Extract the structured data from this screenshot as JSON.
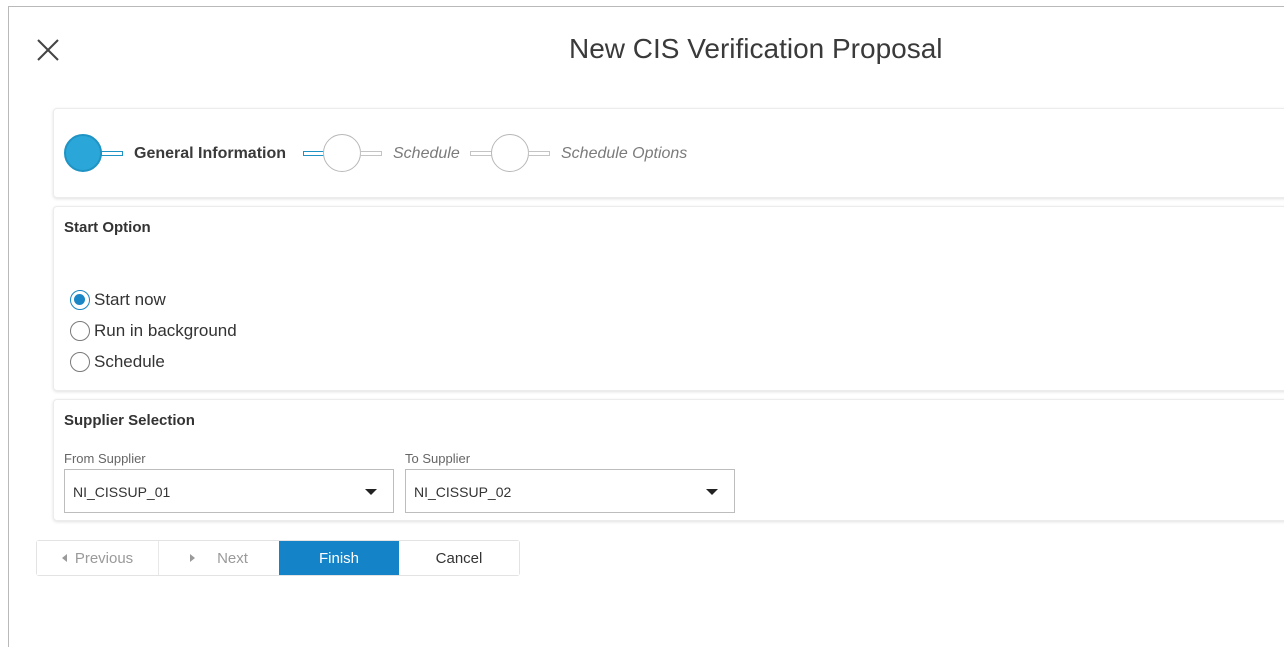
{
  "dialog": {
    "title": "New CIS Verification Proposal",
    "close_icon": "close-icon"
  },
  "wizard": {
    "steps": [
      {
        "label": "General Information",
        "state": "active"
      },
      {
        "label": "Schedule",
        "state": "inactive"
      },
      {
        "label": "Schedule Options",
        "state": "inactive"
      }
    ]
  },
  "start_option": {
    "title": "Start Option",
    "options": [
      {
        "label": "Start now",
        "checked": true
      },
      {
        "label": "Run in background",
        "checked": false
      },
      {
        "label": "Schedule",
        "checked": false
      }
    ]
  },
  "supplier_selection": {
    "title": "Supplier Selection",
    "from": {
      "label": "From Supplier",
      "value": "NI_CISSUP_01"
    },
    "to": {
      "label": "To Supplier",
      "value": "NI_CISSUP_02"
    }
  },
  "buttons": {
    "previous": "Previous",
    "next": "Next",
    "finish": "Finish",
    "cancel": "Cancel"
  },
  "colors": {
    "accent": "#1483c7",
    "step_active": "#2aa7d8"
  }
}
